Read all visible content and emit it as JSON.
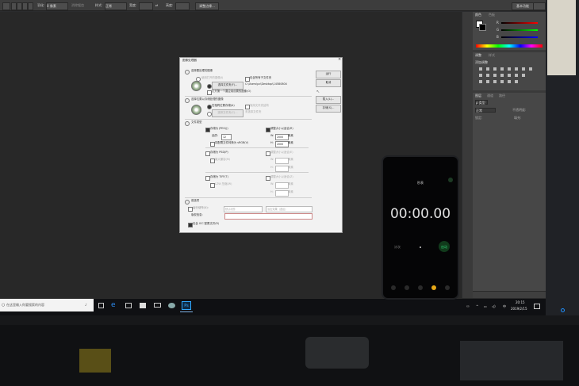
{
  "photoshop": {
    "option_bar": {
      "mode_label": "正常",
      "style_label": "样式:",
      "style_value": "正常",
      "width_label": "宽度:",
      "height_label": "高度:",
      "adjust_button": "调整边缘...",
      "workspace": "基本功能",
      "opacity_field": "0 像素",
      "anti_alias": "消除锯齿"
    },
    "panels": {
      "color_tab": "颜色",
      "swatches_tab": "色板",
      "adjustments_tab": "调整",
      "styles_tab": "样式",
      "add_adjustment": "添加调整",
      "layers_tab": "图层",
      "channels_tab": "通道",
      "paths_tab": "路径",
      "kind_label": "ρ 类型",
      "blend_mode": "正常",
      "opacity_label": "不透明度:",
      "lock_label": "锁定:",
      "fill_label": "填充:",
      "color_channels": [
        "R",
        "G",
        "B"
      ]
    }
  },
  "dialog": {
    "title": "图像处理器",
    "step1": "选择要处理的图像",
    "use_open_images": "使用打开的图像(I)",
    "include_subfolders": "包含所有子文件夹",
    "select_folder_btn": "选择文件夹(F)...",
    "folder_path": "C:\\Users\\pc\\Desktop\\14580804",
    "open_first": "打开第一个要应用设置的图像(O)",
    "step2": "选择位置以存储处理的图像",
    "save_same_location": "在相同位置存储(A)",
    "keep_structure": "保持文件夹结构",
    "select_folder_btn2": "选择文件夹(C)...",
    "no_folder": "未选择文件夹",
    "step3": "文件类型",
    "save_jpeg": "存储为 JPEG(J)",
    "resize_fit": "调整大小以适合(R)",
    "quality_label": "品质:",
    "quality_value": "12",
    "w_label": "W:",
    "w_value": "2000",
    "h_label": "H:",
    "h_value": "2000",
    "px": "像素",
    "convert_srgb": "将配置文件转换为 sRGB(V)",
    "save_psd": "存储为 PSD(P)",
    "resize_fit2": "调整大小以适合(E)",
    "max_compat": "最大兼容(M)",
    "save_tiff": "存储为 TIFF(T)",
    "resize_fit3": "调整大小以适合(Z)",
    "lzw": "LZW 压缩(W)",
    "step4": "首选项",
    "run_action": "运行动作(U):",
    "action_set": "默认动作",
    "action_name": "淡出效果（选区）",
    "copyright": "版权信息:",
    "include_icc": "包含 ICC 配置文件(R)",
    "run_btn": "运行",
    "cancel_btn": "取消",
    "load_btn": "载入(L)...",
    "save_btn": "存储(S)..."
  },
  "taskbar": {
    "search_placeholder": "在这里输入你要搜索的内容",
    "time": "20:15",
    "date": "2019/2/15",
    "ime": "中"
  },
  "phone": {
    "header": "秒表",
    "timer": "00:00.00",
    "left_button": "计次",
    "right_button": "启动"
  }
}
